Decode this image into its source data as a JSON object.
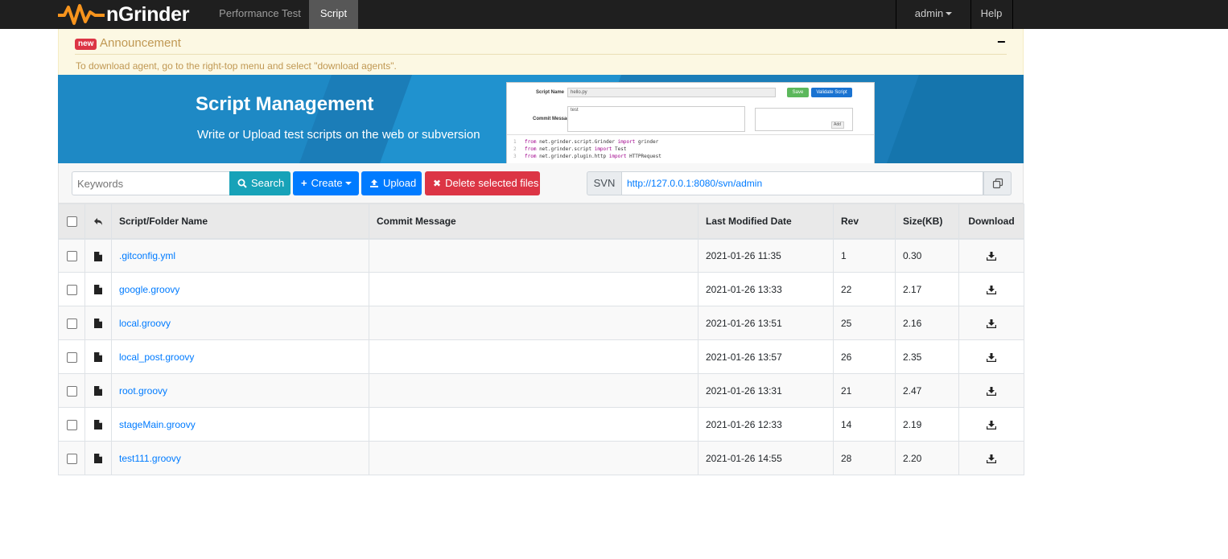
{
  "navbar": {
    "brand": "nGrinder",
    "items": [
      {
        "label": "Performance Test"
      },
      {
        "label": "Script"
      }
    ],
    "user": "admin",
    "help": "Help"
  },
  "announcement": {
    "badge": "new",
    "title": "Announcement",
    "collapse": "−",
    "body": "To download agent, go to the right-top menu and select \"download agents\"."
  },
  "banner": {
    "title": "Script Management",
    "subtitle": "Write or Upload test scripts on the web or subversion",
    "mock": {
      "script_name_label": "Script Name",
      "script_name_value": "hello.py",
      "save": "Save",
      "validate": "Validate Script",
      "commit_label": "Commit Message",
      "commit_value": "test",
      "add": "Add",
      "code": [
        {
          "n": "1",
          "kw1": "from",
          "mid": " net.grinder.script.Grinder ",
          "kw2": "import",
          "tail": " grinder"
        },
        {
          "n": "2",
          "kw1": "from",
          "mid": " net.grinder.script ",
          "kw2": "import",
          "tail": " Test"
        },
        {
          "n": "3",
          "kw1": "from",
          "mid": " net.grinder.plugin.http ",
          "kw2": "import",
          "tail": " HTTPRequest"
        }
      ]
    }
  },
  "toolbar": {
    "keywords_placeholder": "Keywords",
    "search": "Search",
    "create": "Create",
    "upload": "Upload",
    "delete": "Delete selected files",
    "svn_label": "SVN",
    "svn_url": "http://127.0.0.1:8080/svn/admin"
  },
  "table": {
    "headers": {
      "name": "Script/Folder Name",
      "commit": "Commit Message",
      "date": "Last Modified Date",
      "rev": "Rev",
      "size": "Size(KB)",
      "download": "Download"
    },
    "rows": [
      {
        "name": ".gitconfig.yml",
        "commit": "",
        "date": "2021-01-26 11:35",
        "rev": "1",
        "size": "0.30"
      },
      {
        "name": "google.groovy",
        "commit": "",
        "date": "2021-01-26 13:33",
        "rev": "22",
        "size": "2.17"
      },
      {
        "name": "local.groovy",
        "commit": "",
        "date": "2021-01-26 13:51",
        "rev": "25",
        "size": "2.16"
      },
      {
        "name": "local_post.groovy",
        "commit": "",
        "date": "2021-01-26 13:57",
        "rev": "26",
        "size": "2.35"
      },
      {
        "name": "root.groovy",
        "commit": "",
        "date": "2021-01-26 13:31",
        "rev": "21",
        "size": "2.47"
      },
      {
        "name": "stageMain.groovy",
        "commit": "",
        "date": "2021-01-26 12:33",
        "rev": "14",
        "size": "2.19"
      },
      {
        "name": "test111.groovy",
        "commit": "",
        "date": "2021-01-26 14:55",
        "rev": "28",
        "size": "2.20"
      }
    ]
  },
  "colors": {
    "navbar": "#1f1f1f",
    "brand_orange": "#f7941d",
    "link": "#007bff",
    "search_btn": "#17a2b8",
    "primary_btn": "#007bff",
    "danger_btn": "#dc3545",
    "announce_bg": "#fcf8e3",
    "banner_bg": "#1b7db8"
  }
}
